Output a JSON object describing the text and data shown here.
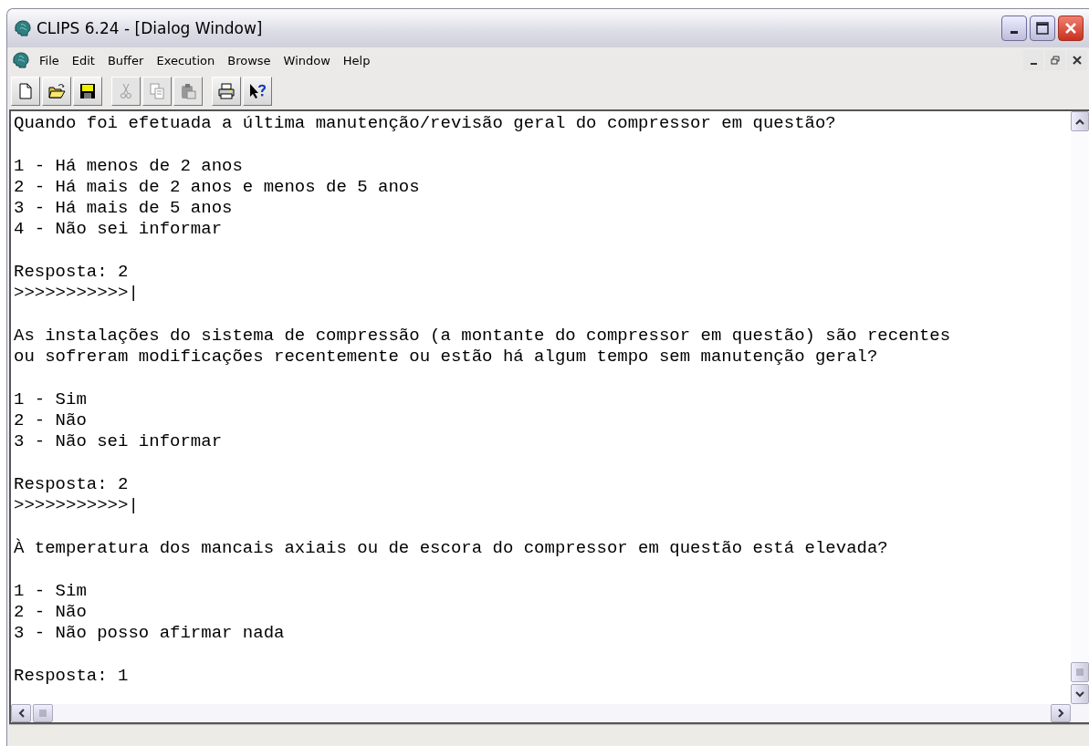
{
  "window": {
    "title": "CLIPS 6.24 - [Dialog Window]"
  },
  "menu": [
    "File",
    "Edit",
    "Buffer",
    "Execution",
    "Browse",
    "Window",
    "Help"
  ],
  "toolbar": [
    [
      {
        "kind": "new",
        "disabled": false
      },
      {
        "kind": "open",
        "disabled": false
      },
      {
        "kind": "save",
        "disabled": false
      }
    ],
    [
      {
        "kind": "cut",
        "disabled": true
      },
      {
        "kind": "copy",
        "disabled": true
      },
      {
        "kind": "paste",
        "disabled": true
      }
    ],
    [
      {
        "kind": "print",
        "disabled": false
      },
      {
        "kind": "help",
        "disabled": false
      }
    ]
  ],
  "dialog": {
    "blocks": [
      [
        "Quando foi efetuada a última manutenção/revisão geral do compressor em questão?"
      ],
      [
        "1 - Há menos de 2 anos",
        "2 - Há mais de 2 anos e menos de 5 anos",
        "3 - Há mais de 5 anos",
        "4 - Não sei informar"
      ],
      [
        "Resposta: 2",
        ">>>>>>>>>>>|"
      ],
      [
        "As instalações do sistema de compressão (a montante do compressor em questão) são recentes",
        "ou sofreram modificações recentemente ou estão há algum tempo sem manutenção geral?"
      ],
      [
        "1 - Sim",
        "2 - Não",
        "3 - Não sei informar"
      ],
      [
        "Resposta: 2",
        ">>>>>>>>>>>|"
      ],
      [
        "À temperatura dos mancais axiais ou de escora do compressor em questão está elevada?"
      ],
      [
        "1 - Sim",
        "2 - Não",
        "3 - Não posso afirmar nada"
      ],
      [
        "Resposta: 1"
      ]
    ]
  }
}
